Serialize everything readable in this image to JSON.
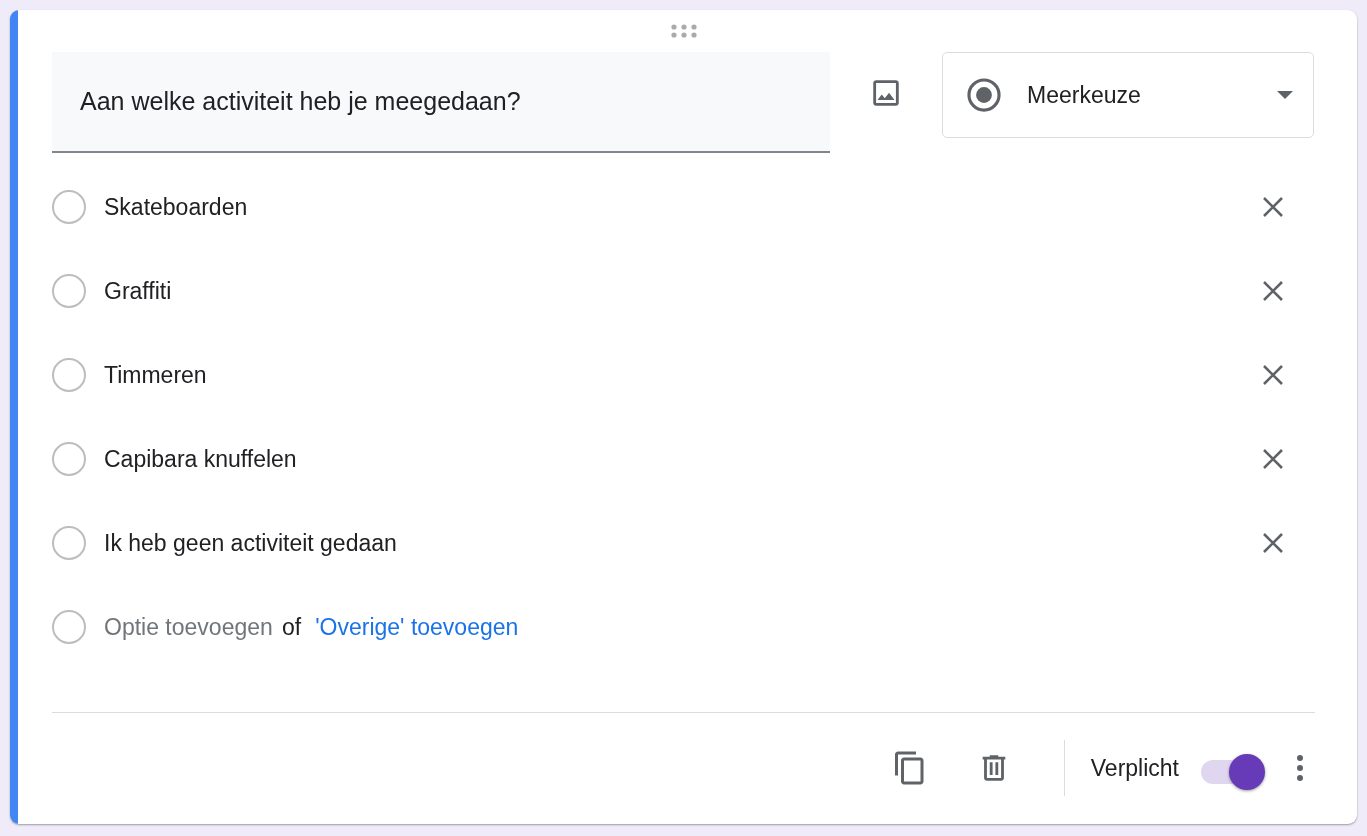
{
  "question": {
    "value": "Aan welke activiteit heb je meegedaan?"
  },
  "type_dropdown": {
    "label": "Meerkeuze"
  },
  "options": [
    {
      "label": "Skateboarden",
      "selected": false
    },
    {
      "label": "Graffiti",
      "selected": false
    },
    {
      "label": "Timmeren",
      "selected": false
    },
    {
      "label": "Capibara knuffelen",
      "selected": false
    },
    {
      "label": "Ik heb geen activiteit gedaan",
      "selected": false
    }
  ],
  "add_option": {
    "selected": false,
    "placeholder": "Optie toevoegen",
    "separator": "of",
    "add_other_link": "'Overige' toevoegen"
  },
  "footer": {
    "required": {
      "label": "Verplicht",
      "on": true
    }
  }
}
